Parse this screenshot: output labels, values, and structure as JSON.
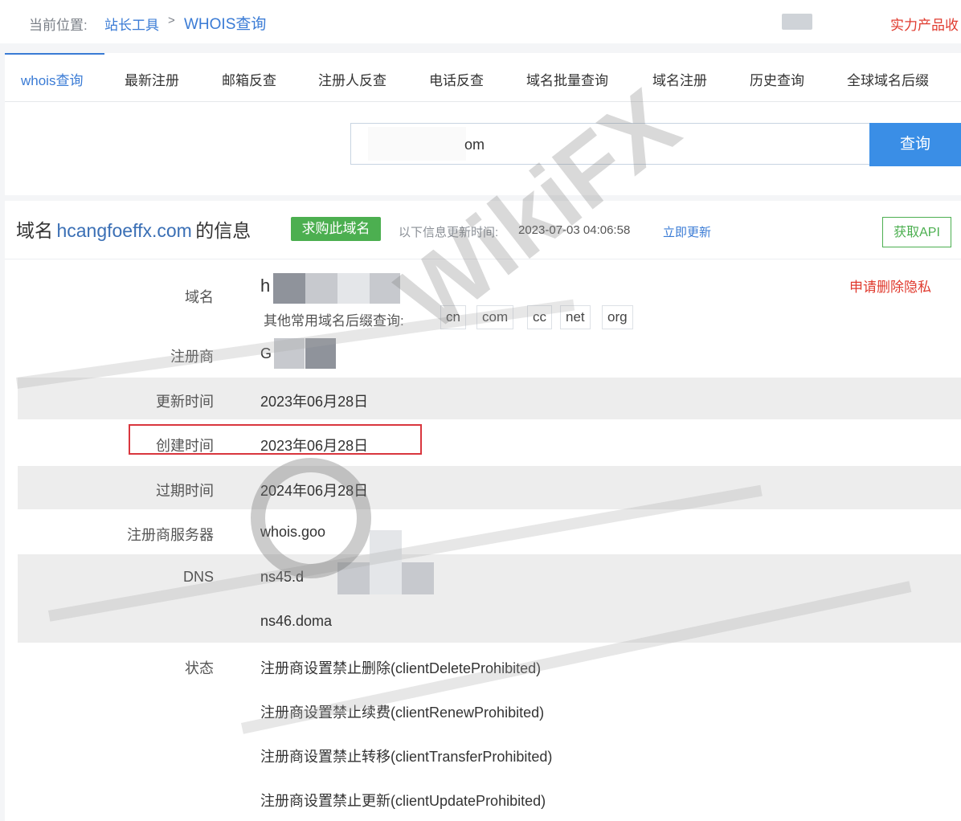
{
  "breadcrumb": {
    "label": "当前位置:",
    "home": "站长工具",
    "separator": ">",
    "current": "WHOIS查询",
    "right_text": "实力产品收"
  },
  "tabs": [
    {
      "label": "whois查询",
      "active": true
    },
    {
      "label": "最新注册"
    },
    {
      "label": "邮箱反查"
    },
    {
      "label": "注册人反查"
    },
    {
      "label": "电话反查"
    },
    {
      "label": "域名批量查询"
    },
    {
      "label": "域名注册"
    },
    {
      "label": "历史查询"
    },
    {
      "label": "全球域名后缀"
    }
  ],
  "search": {
    "value": "om",
    "button": "查询"
  },
  "info": {
    "title_prefix": "域名",
    "domain": "hcangfoeffx.com",
    "title_suffix": "的信息",
    "buy_badge": "求购此域名",
    "updated_label": "以下信息更新时间:",
    "updated_time": "2023-07-03 04:06:58",
    "refresh_link": "立即更新",
    "api_button": "获取API",
    "privacy_link": "申请删除隐私"
  },
  "rows": {
    "domain": {
      "label": "域名",
      "value": "h"
    },
    "suffix_label": "其他常用域名后缀查询:",
    "suffixes": [
      "cn",
      "com",
      "cc",
      "net",
      "org"
    ],
    "registrar": {
      "label": "注册商",
      "value": "G"
    },
    "updated": {
      "label": "更新时间",
      "value": "2023年06月28日"
    },
    "created": {
      "label": "创建时间",
      "value": "2023年06月28日"
    },
    "expires": {
      "label": "过期时间",
      "value": "2024年06月28日"
    },
    "whois_server": {
      "label": "注册商服务器",
      "value": "whois.goo"
    },
    "dns": {
      "label": "DNS",
      "values": [
        "ns45.d",
        "ns46.doma"
      ]
    },
    "status": {
      "label": "状态",
      "values": [
        "注册商设置禁止删除(clientDeleteProhibited)",
        "注册商设置禁止续费(clientRenewProhibited)",
        "注册商设置禁止转移(clientTransferProhibited)",
        "注册商设置禁止更新(clientUpdateProhibited)"
      ]
    }
  },
  "watermark": "WikiFX",
  "colors": {
    "accent": "#3a7bd5",
    "buy_green": "#4caf50",
    "warning_red": "#e03b2f",
    "highlight_red": "#d9363e"
  }
}
